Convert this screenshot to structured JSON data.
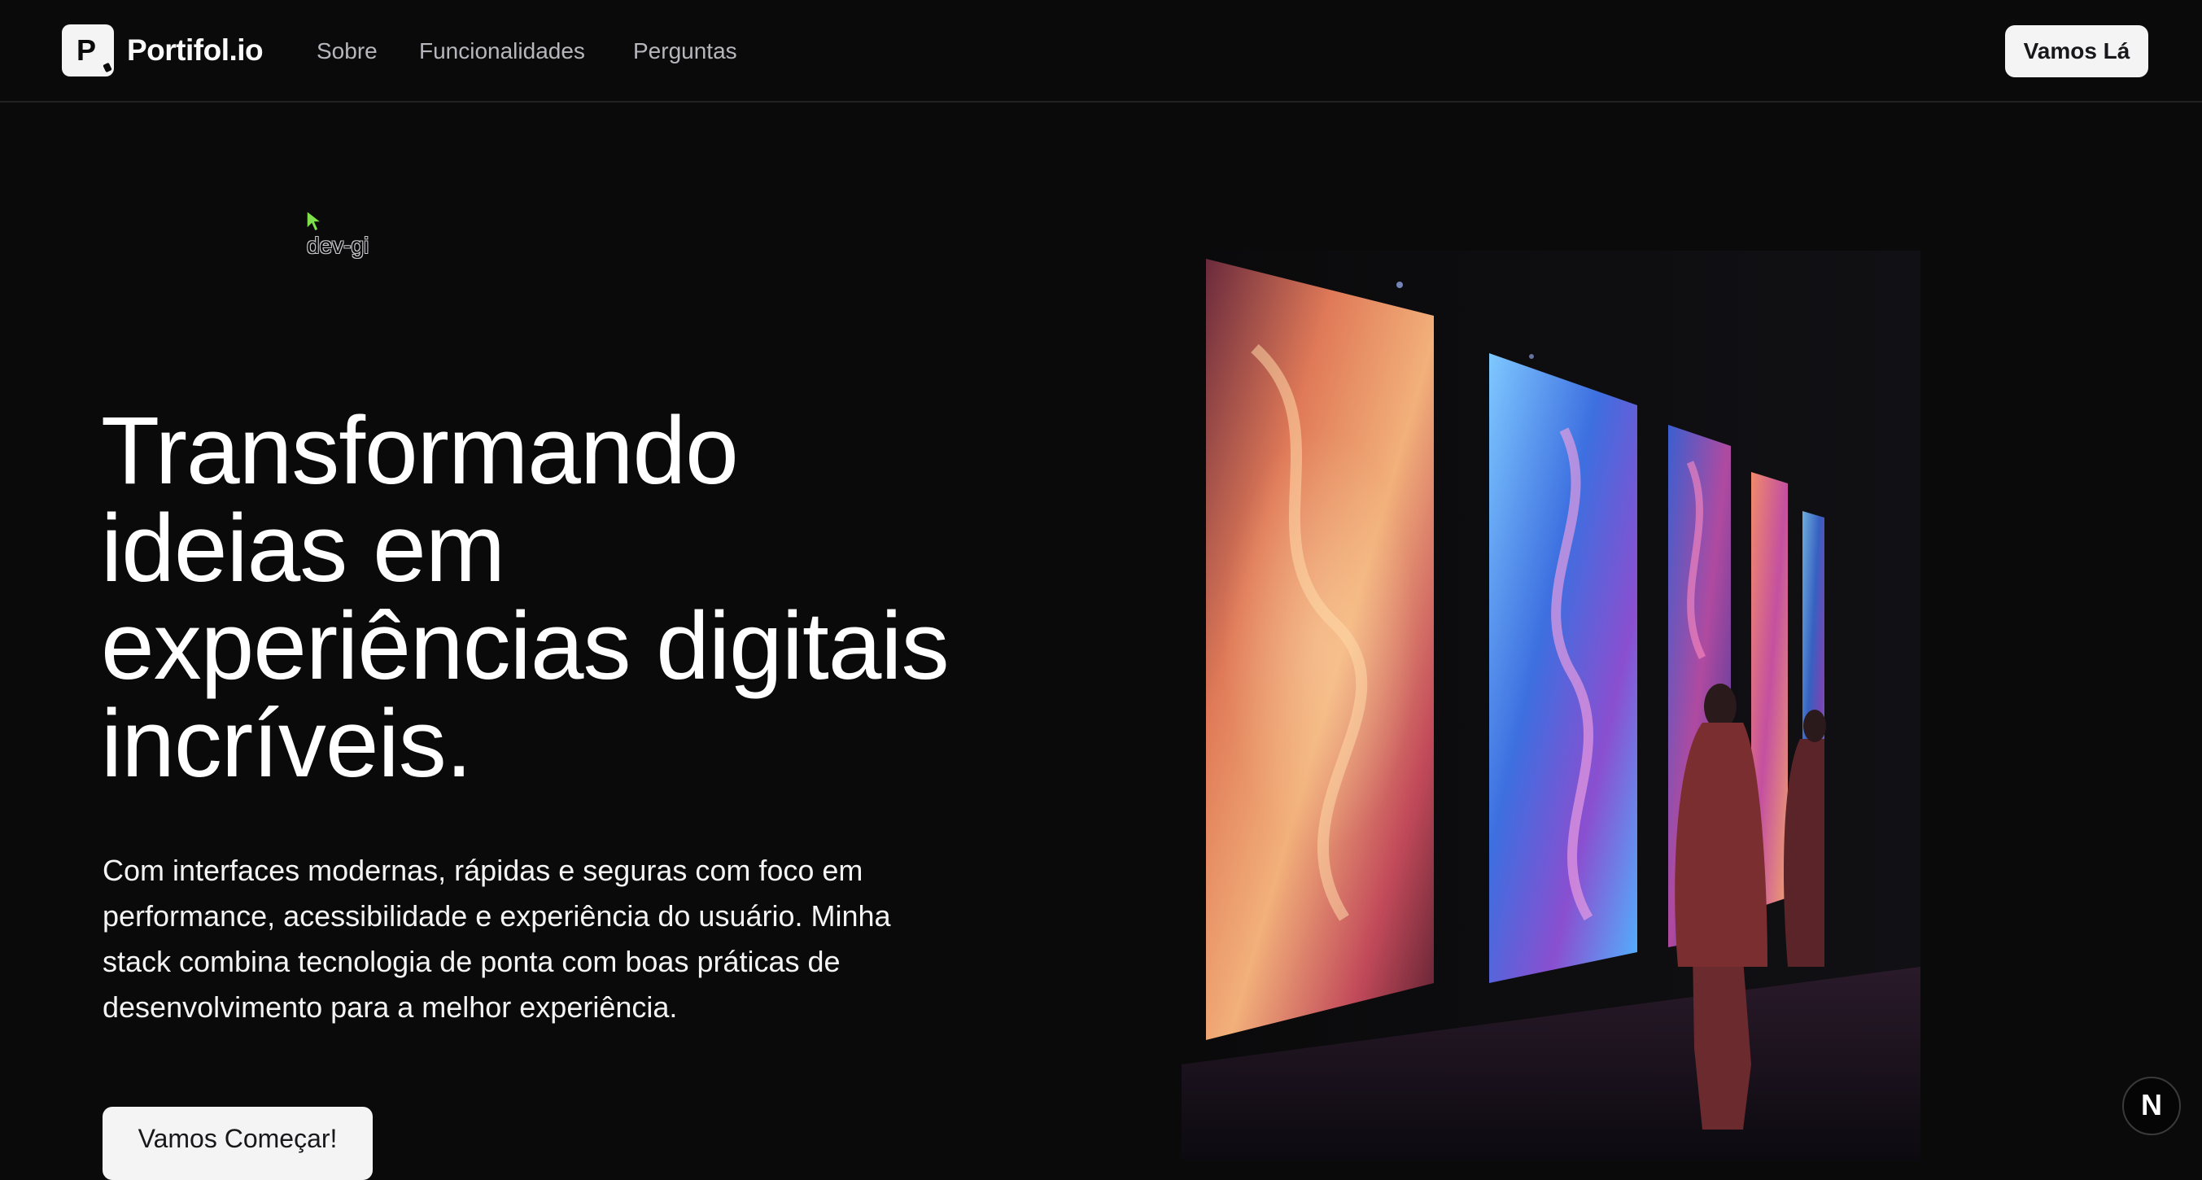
{
  "navbar": {
    "logo_letter": "P",
    "brand": "Portifol.io",
    "links": [
      {
        "label": "Sobre"
      },
      {
        "label": "Funcionalidades"
      },
      {
        "label": "Perguntas"
      }
    ],
    "cta_label": "Vamos Lá"
  },
  "cursor": {
    "label": "dev-gi",
    "color": "#7ee04a"
  },
  "hero": {
    "headline": "Transformando ideias em experiências digitais incríveis.",
    "description": "Com interfaces modernas, rápidas e seguras com foco em performance, acessibilidade e experiência do usuário. Minha stack combina tecnologia de ponta com boas práticas de desenvolvimento para a melhor experiência.",
    "cta_label": "Vamos Começar!",
    "image": {
      "subject": "dragon-art-gallery-image"
    }
  },
  "dev_badge": {
    "letter": "N"
  },
  "colors": {
    "background": "#0a0a0b",
    "button_bg": "#f4f4f5",
    "nav_text": "#b6b6bc"
  }
}
